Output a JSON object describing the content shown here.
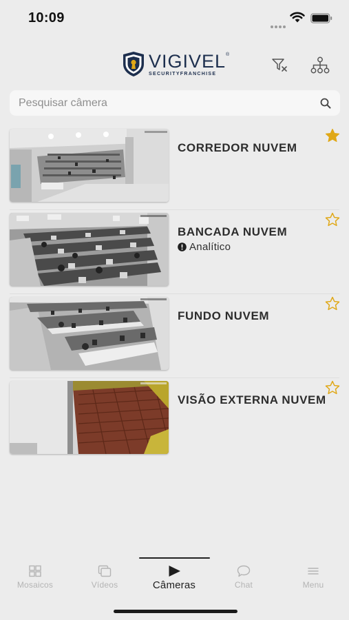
{
  "status_bar": {
    "time": "10:09"
  },
  "header": {
    "logo": {
      "title": "VIGIVEL",
      "subtitle": "SECURITYFRANCHISE",
      "registered": "®"
    },
    "filter_clear_icon": "filter-clear-icon",
    "hierarchy_icon": "hierarchy-icon"
  },
  "search": {
    "placeholder": "Pesquisar câmera",
    "value": ""
  },
  "cameras": [
    {
      "name": "CORREDOR NUVEM",
      "favorite": true,
      "badge": null,
      "scene": "office-corridor"
    },
    {
      "name": "BANCADA NUVEM",
      "favorite": false,
      "badge": "Analítico",
      "scene": "office-desks"
    },
    {
      "name": "FUNDO NUVEM",
      "favorite": false,
      "badge": null,
      "scene": "office-back"
    },
    {
      "name": "VISÃO EXTERNA NUVEM",
      "favorite": false,
      "badge": null,
      "scene": "roof-outside"
    }
  ],
  "tabs": [
    {
      "label": "Mosaicos",
      "icon": "grid-icon",
      "active": false
    },
    {
      "label": "Vídeos",
      "icon": "videos-icon",
      "active": false
    },
    {
      "label": "Câmeras",
      "icon": "play-icon",
      "active": true
    },
    {
      "label": "Chat",
      "icon": "chat-bubble-icon",
      "active": false
    },
    {
      "label": "Menu",
      "icon": "menu-icon",
      "active": false
    }
  ],
  "colors": {
    "background": "#ececec",
    "star_gold": "#e0a817",
    "brand_navy": "#1d2f4e",
    "tab_inactive": "#b4b4b4"
  }
}
